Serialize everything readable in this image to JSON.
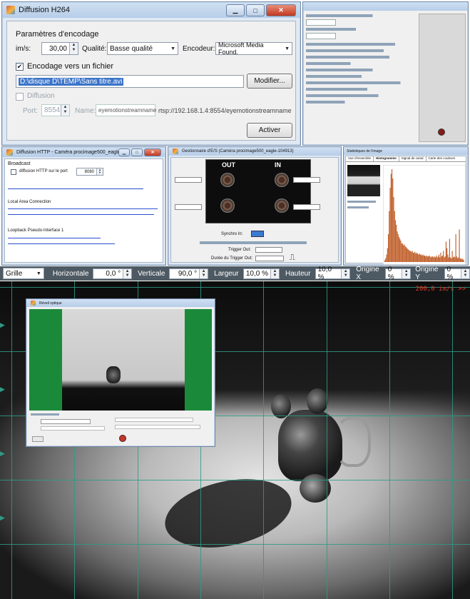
{
  "h264": {
    "title": "Diffusion H264",
    "section": "Paramètres d'encodage",
    "fps_label": "im/s:",
    "fps_value": "30,00",
    "quality_label": "Qualité:",
    "quality_value": "Basse qualité",
    "encoder_label": "Encodeur:",
    "encoder_value": "Microsoft Media Found.",
    "encode_file_label": "Encodage vers un fichier",
    "file_path": "D:\\disque D\\TEMP\\Sans titre.avi",
    "modify_label": "Modifier...",
    "broadcast_label": "Diffusion",
    "port_label": "Port:",
    "port_value": "8554",
    "name_label": "Name:",
    "name_value": "eyemotionstreamname",
    "rtsp_url": "rtsp://192.168.1.4:8554/eyemotionstreamname",
    "activate_label": "Activer"
  },
  "http": {
    "title": "Diffusion HTTP - Caméra procimage500_eagle-...",
    "broadcast_heading": "Broadcast",
    "http_port_label": "diffusion HTTP sur le port",
    "http_port_value": "8080",
    "lan_heading": "Local Area Connection",
    "loopback_heading": "Loopback Pseudo-Interface 1"
  },
  "io": {
    "title": "Gestionnaire d'E/S (Caméra procimage500_eagle-104913)",
    "out_label": "OUT",
    "in_label": "IN",
    "sync_label": "Synchro In:",
    "trigger_out_label": "Trigger Out:",
    "trigger_duration_label": "Durée du Trigger Out:"
  },
  "hist": {
    "title": "Statistiques de l'image",
    "tabs": [
      "Vue d'ensemble",
      "Histogramme",
      "Signal de canal",
      "Carte des couleurs"
    ],
    "bins": [
      0.02,
      0.04,
      0.08,
      0.15,
      0.3,
      0.55,
      0.8,
      0.95,
      1,
      0.9,
      0.7,
      0.55,
      0.45,
      0.4,
      0.33,
      0.3,
      0.27,
      0.25,
      0.23,
      0.2,
      0.2,
      0.18,
      0.19,
      0.17,
      0.16,
      0.15,
      0.14,
      0.13,
      0.12,
      0.12,
      0.11,
      0.12,
      0.1,
      0.1,
      0.11,
      0.09,
      0.1,
      0.09,
      0.08,
      0.09,
      0.08,
      0.08,
      0.07,
      0.08,
      0.07,
      0.07,
      0.06,
      0.07,
      0.06,
      0.06,
      0.07,
      0.06,
      0.05,
      0.06,
      0.06,
      0.05,
      0.06,
      0.05,
      0.07,
      0.05,
      0.06,
      0.08,
      0.05,
      0.1,
      0.06,
      0.07,
      0.12,
      0.05,
      0.06,
      0.22,
      0.15,
      0.08,
      0.05,
      0.25,
      0.05,
      0.04,
      0.12,
      0.05,
      0.06,
      0.05,
      0.3,
      0.06,
      0.04,
      0.05,
      0.35,
      0.04,
      0.03,
      0.04,
      0.03,
      0.02
    ],
    "bar_color": "#c0602c"
  },
  "toolbar": {
    "grid_label": "Grille",
    "horizontal_label": "Horizontale",
    "horizontal_value": "0,0 °",
    "vertical_label": "Verticale",
    "vertical_value": "90,0 °",
    "width_label": "Largeur",
    "width_value": "10,0 %",
    "height_label": "Hauteur",
    "height_value": "10,0 %",
    "origin_x_label": "Origine X",
    "origin_x_value": "0 %",
    "origin_y_label": "Origine Y",
    "origin_y_value": "0 %"
  },
  "viewer": {
    "rate_overlay": "200,0 im/s >>",
    "overlay_color": "#e23a2a",
    "grid_color": "#2f9a86"
  },
  "inset": {
    "title": "Réveil optique"
  }
}
